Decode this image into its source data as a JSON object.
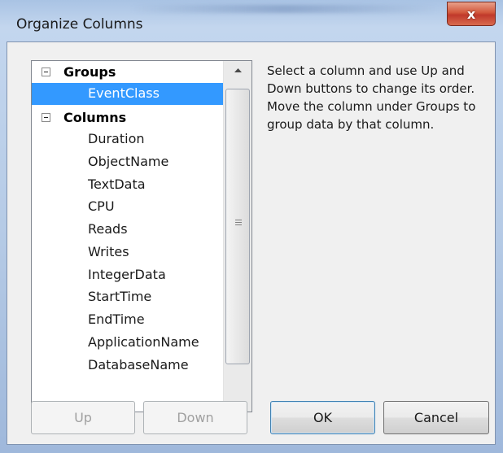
{
  "window": {
    "title": "Organize Columns",
    "close_label": "x"
  },
  "tree": {
    "groups_label": "Groups",
    "groups_items": [
      "EventClass"
    ],
    "selected_item": "EventClass",
    "columns_label": "Columns",
    "columns_items": [
      "Duration",
      "ObjectName",
      "TextData",
      "CPU",
      "Reads",
      "Writes",
      "IntegerData",
      "StartTime",
      "EndTime",
      "ApplicationName",
      "DatabaseName"
    ]
  },
  "description": "Select a column and use Up and Down buttons to change its order. Move the column under Groups to group data by that column.",
  "buttons": {
    "up": "Up",
    "down": "Down",
    "ok": "OK",
    "cancel": "Cancel"
  },
  "colors": {
    "selection": "#3399ff",
    "close_button": "#c0392b",
    "frame": "#b6cbe6"
  }
}
